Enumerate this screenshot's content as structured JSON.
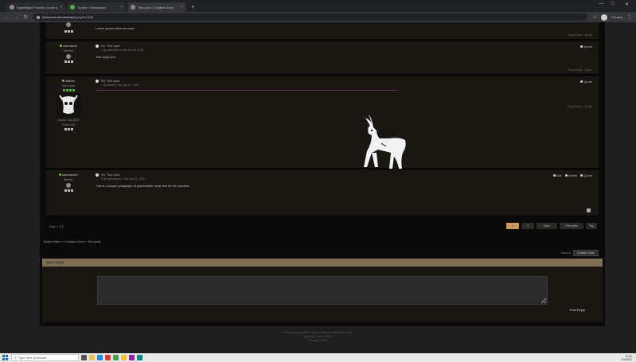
{
  "browser": {
    "tabs": [
      {
        "title": "Spaceflight Forums • Index page",
        "active": false
      },
      {
        "title": "Tumblr • Dashboard",
        "active": false
      },
      {
        "title": "Test post • Creative Zone",
        "active": true
      }
    ],
    "new_tab": "+",
    "url": "flashpoint.site/viewtopic.php?t=1234",
    "paused": "Paused",
    "window_controls": [
      "—",
      "□",
      "✕"
    ]
  },
  "posts": [
    {
      "author": "",
      "rank": "",
      "subject": "",
      "by": "",
      "text": "Lorem ipsum dolor sit amet.",
      "report": "Report post  ·  Quote"
    },
    {
      "author": "username",
      "rank": "Member",
      "subject": "Re: Test post",
      "by": "» by username » Sat Jan 01, 2022",
      "text": "Test reply text",
      "quote": "Quote",
      "report": "Report post  ·  Quote"
    },
    {
      "author": "Admin",
      "rank": "Site Admin",
      "subject": "Re: Test post",
      "by": "» by Admin » Sat Jan 01, 2022",
      "text": "",
      "quote": "Quote",
      "report": "Report post  ·  Quote",
      "joined": "Joined: Jan 2022",
      "posts_count": "Posts: 420"
    },
    {
      "author": "username2",
      "rank": "Member",
      "subject": "Re: Test post",
      "by": "» by username2 » Sat Jan 01, 2022",
      "text": "This is a longer paragraph of placeholder reply text for the preview.",
      "actions": [
        "Edit",
        "Delete",
        "Quote"
      ]
    }
  ],
  "pagination": {
    "label": "Page 1 of 5",
    "buttons": [
      "1",
      "2",
      "Next",
      "Print view",
      "Top"
    ]
  },
  "breadcrumb": "Board index » Creative Zone » Test post",
  "jump": {
    "label": "Jump to",
    "value": "Creative Zone"
  },
  "quick_reply": {
    "title": "Quick Reply",
    "hint": "",
    "post_button": "Post Reply"
  },
  "footer": {
    "lines": [
      "Powered by phpBB® Forum Software © phpBB Limited",
      "Style by Creative Zone",
      "Privacy | Terms"
    ]
  },
  "taskbar": {
    "search_placeholder": "Type here to search",
    "time": "12:00",
    "date": "1/1/2022"
  },
  "colors": {
    "accent": "#c79b5c",
    "header_bar": "#7d6e54",
    "online": "#6fba3a"
  }
}
